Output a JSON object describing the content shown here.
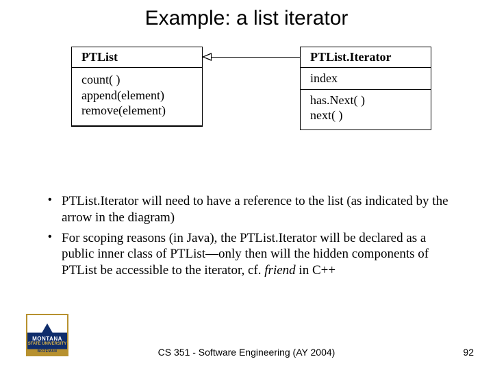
{
  "title": "Example: a list iterator",
  "uml": {
    "left": {
      "name": "PTList",
      "attrs": [
        "count( )",
        "append(element)",
        "remove(element)"
      ]
    },
    "right": {
      "name": "PTList.Iterator",
      "attrs": [
        "index"
      ],
      "ops": [
        "has.Next( )",
        "next( )"
      ]
    }
  },
  "bullets": {
    "b1": "PTList.Iterator will need to have a reference to the list (as indicated by the arrow in the diagram)",
    "b2_a": "For scoping reasons (in Java), the PTList.Iterator will be declared as a public inner class of PTList—only then will the hidden components of PTList be accessible to the iterator, cf. ",
    "b2_friend": "friend",
    "b2_b": " in C++"
  },
  "logo": {
    "line1": "MONTANA",
    "line2": "STATE UNIVERSITY",
    "line3": "BOZEMAN"
  },
  "footer": "CS 351 - Software Engineering (AY 2004)",
  "page": "92"
}
